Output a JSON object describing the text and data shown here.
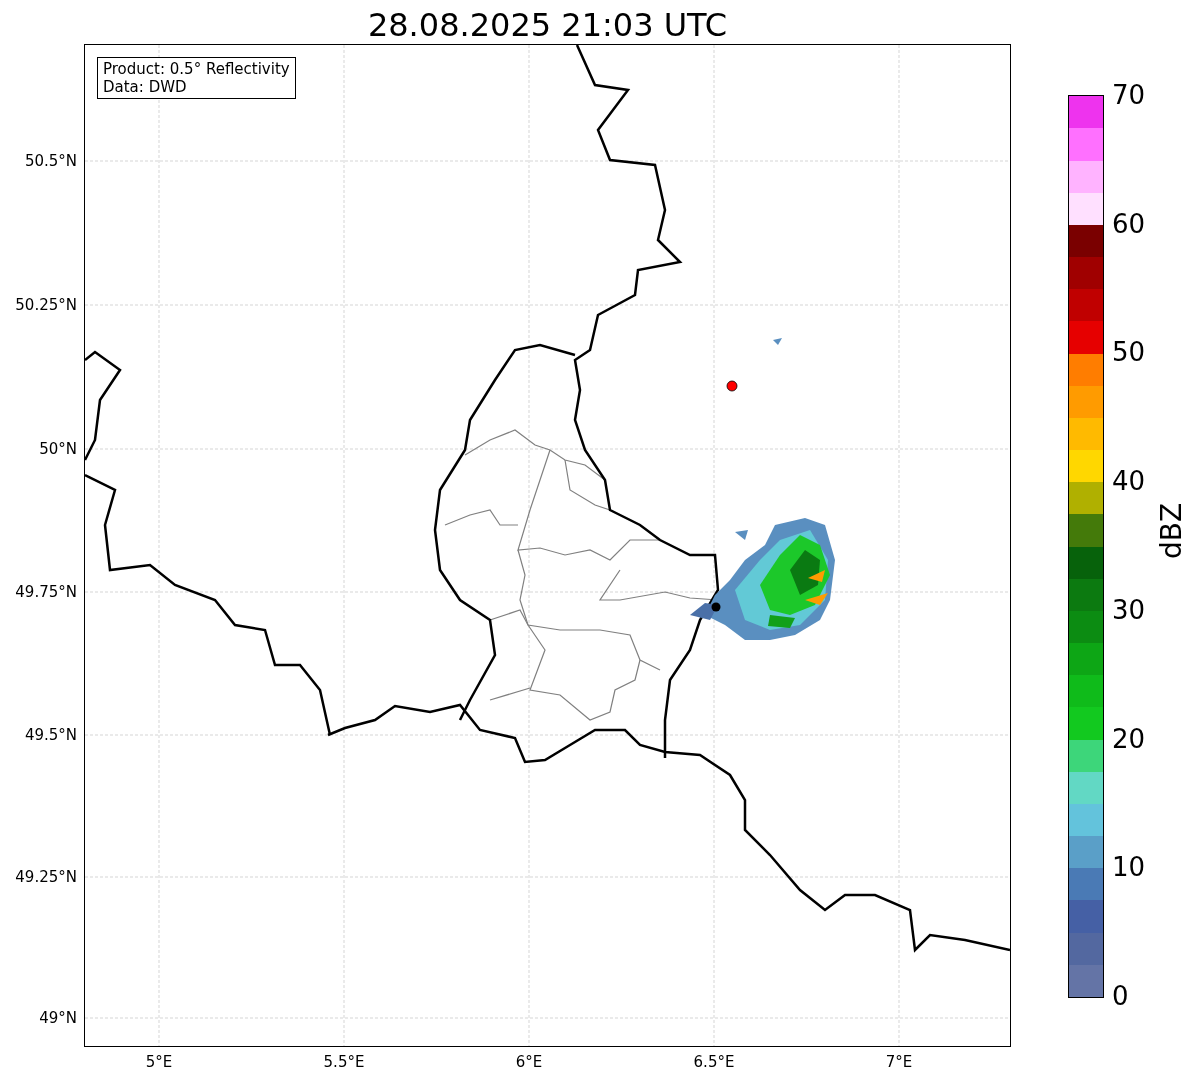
{
  "title": "28.08.2025 21:03 UTC",
  "legend": [
    "Product: 0.5° Reflectivity",
    "Data: DWD"
  ],
  "y_ticks": [
    "50.5°N",
    "50.25°N",
    "50°N",
    "49.75°N",
    "49.5°N",
    "49.25°N",
    "49°N"
  ],
  "x_ticks": [
    "5°E",
    "5.5°E",
    "6°E",
    "6.5°E",
    "7°E"
  ],
  "colorbar": {
    "label": "dBZ",
    "ticks": [
      "70",
      "60",
      "50",
      "40",
      "30",
      "20",
      "10",
      "0"
    ],
    "bins": [
      {
        "color": "#6474a6"
      },
      {
        "color": "#5368a0"
      },
      {
        "color": "#4560a5"
      },
      {
        "color": "#4a7ab5"
      },
      {
        "color": "#5a9fc8"
      },
      {
        "color": "#63c3dc"
      },
      {
        "color": "#62d8c4"
      },
      {
        "color": "#3dd67a"
      },
      {
        "color": "#12c91f"
      },
      {
        "color": "#0fbb1a"
      },
      {
        "color": "#0da615"
      },
      {
        "color": "#0c8c12"
      },
      {
        "color": "#0c7a10"
      },
      {
        "color": "#07620b"
      },
      {
        "color": "#447a0a"
      },
      {
        "color": "#b0b000"
      },
      {
        "color": "#ffd700"
      },
      {
        "color": "#ffba00"
      },
      {
        "color": "#ff9b00"
      },
      {
        "color": "#ff7d00"
      },
      {
        "color": "#e60000"
      },
      {
        "color": "#c00000"
      },
      {
        "color": "#a00000"
      },
      {
        "color": "#7a0000"
      },
      {
        "color": "#ffe0ff"
      },
      {
        "color": "#ffb3ff"
      },
      {
        "color": "#ff70ff"
      },
      {
        "color": "#ee33ee"
      }
    ]
  }
}
